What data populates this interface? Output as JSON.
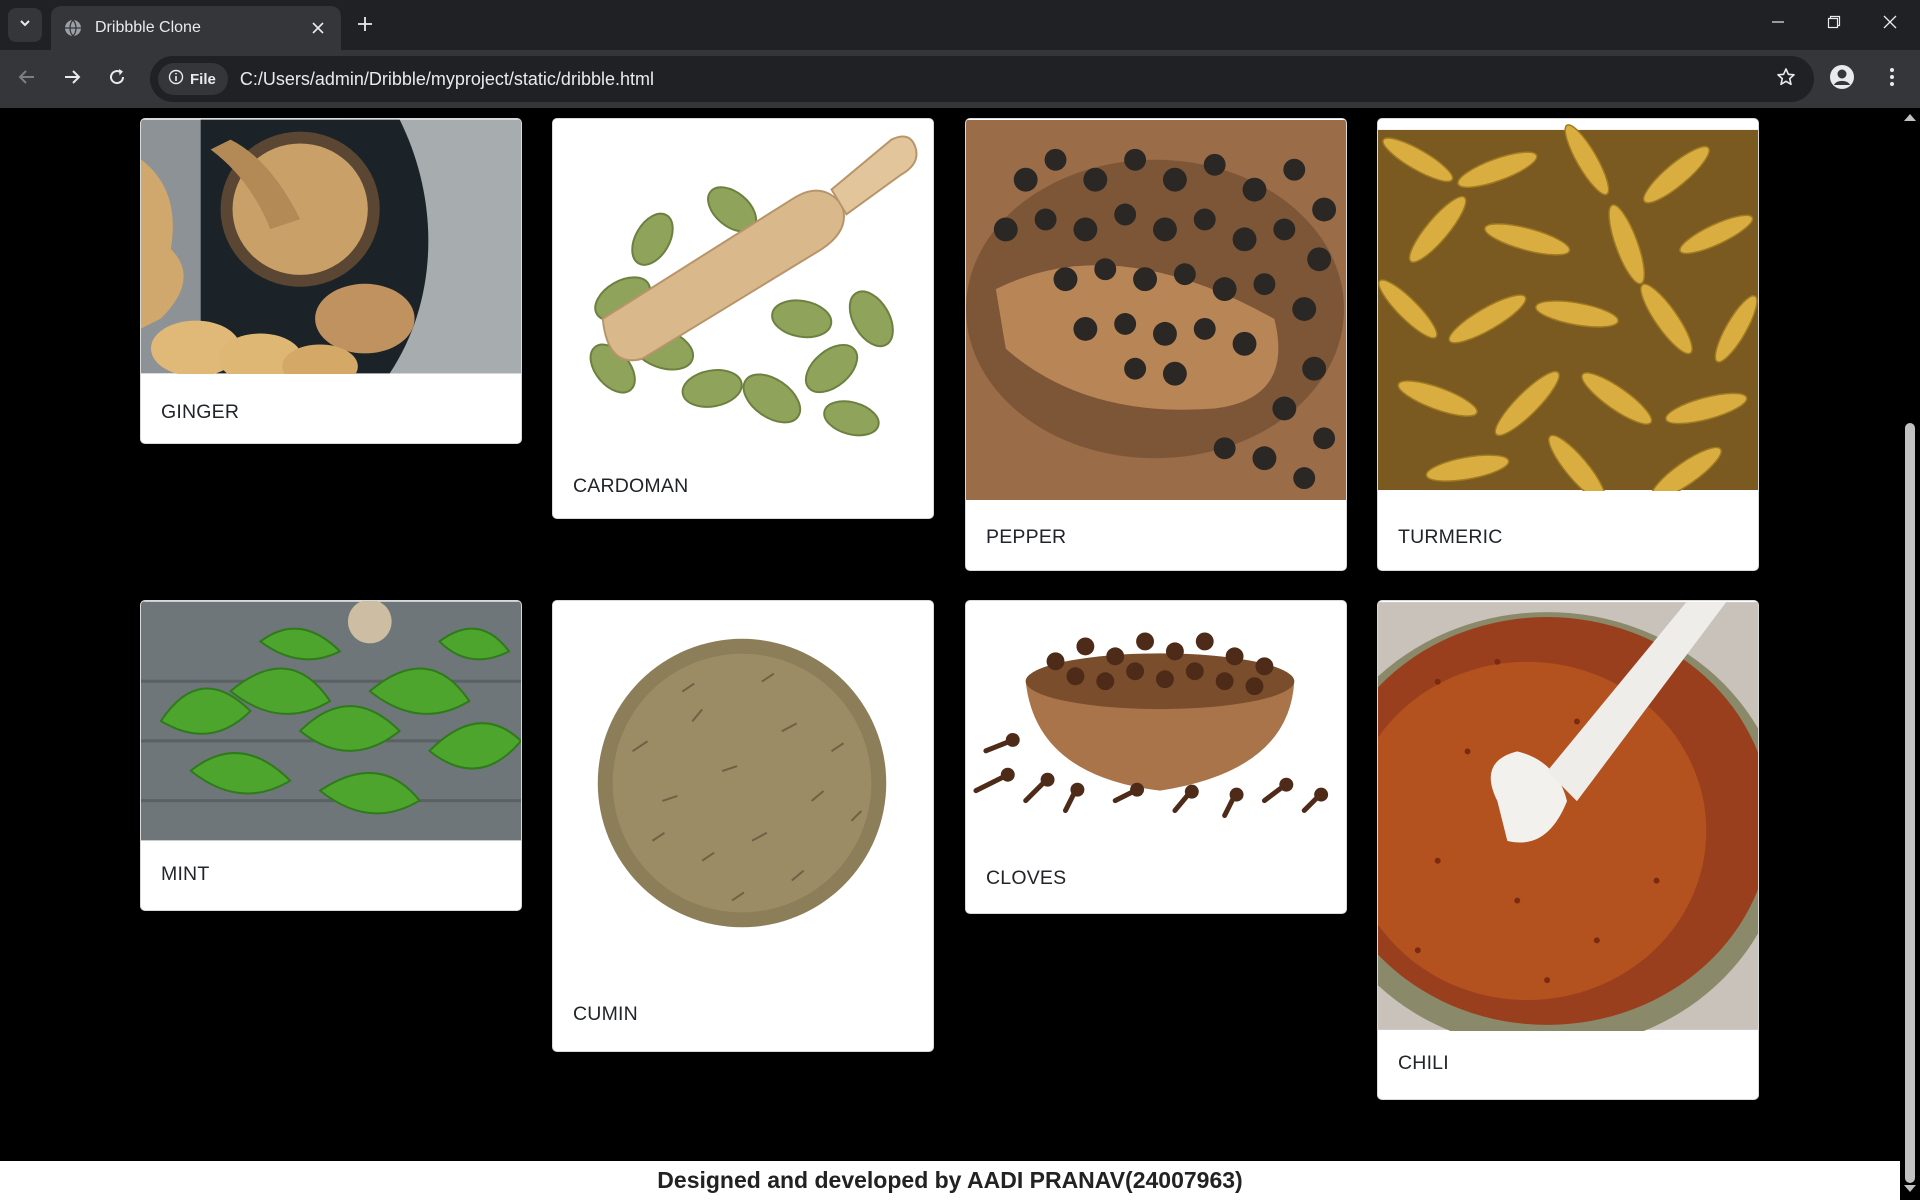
{
  "browser": {
    "tab_title": "Dribbble Clone",
    "chip_label": "File",
    "url": "C:/Users/admin/Dribble/myproject/static/dribble.html",
    "chrome_bg": "#202124",
    "toolbar_bg": "#35363a"
  },
  "cards": [
    {
      "label": "GINGER",
      "icon": "ginger-photo"
    },
    {
      "label": "CARDOMAN",
      "icon": "cardamom-photo"
    },
    {
      "label": "PEPPER",
      "icon": "pepper-photo"
    },
    {
      "label": "TURMERIC",
      "icon": "turmeric-photo"
    },
    {
      "label": "MINT",
      "icon": "mint-photo"
    },
    {
      "label": "CUMIN",
      "icon": "cumin-photo"
    },
    {
      "label": "CLOVES",
      "icon": "cloves-photo"
    },
    {
      "label": "CHILI",
      "icon": "chili-photo"
    }
  ],
  "footer": {
    "text": "Designed and developed by AADI PRANAV(24007963)"
  }
}
